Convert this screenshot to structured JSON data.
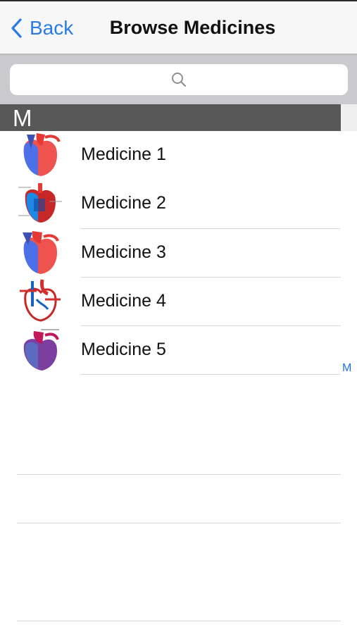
{
  "nav": {
    "back_label": "Back",
    "title": "Browse Medicines"
  },
  "search": {
    "placeholder": ""
  },
  "section": {
    "letter": "M"
  },
  "index": {
    "letters": [
      "M"
    ]
  },
  "medicines": [
    {
      "name": "Medicine 1",
      "icon": "heart-diagram-icon"
    },
    {
      "name": "Medicine 2",
      "icon": "heart-diagram-icon"
    },
    {
      "name": "Medicine 3",
      "icon": "heart-diagram-icon"
    },
    {
      "name": "Medicine 4",
      "icon": "heart-diagram-icon"
    },
    {
      "name": "Medicine 5",
      "icon": "heart-diagram-icon"
    }
  ],
  "colors": {
    "accent": "#1a73e8",
    "section_header": "#585858",
    "search_bar": "#c9c9ce"
  }
}
